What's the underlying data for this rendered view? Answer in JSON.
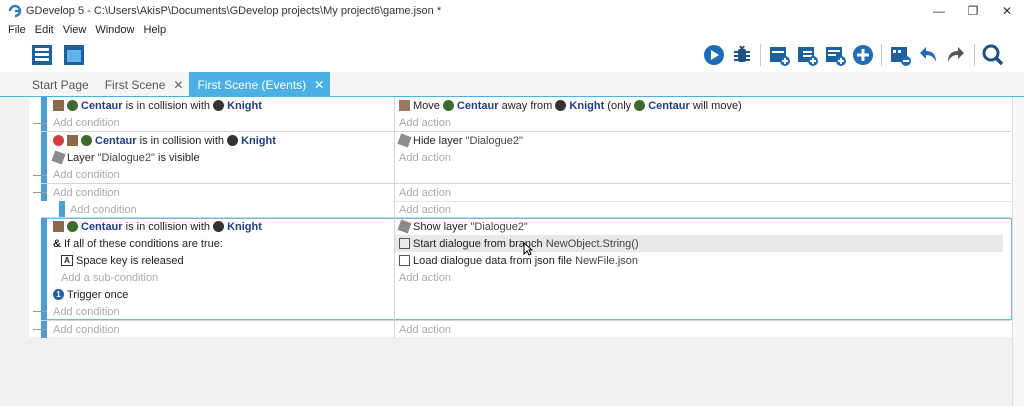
{
  "window": {
    "title": "GDevelop 5 - C:\\Users\\AkisP\\Documents\\GDevelop projects\\My project6\\game.json *",
    "controls": [
      "—",
      "❐",
      "✕"
    ]
  },
  "menu": [
    "File",
    "Edit",
    "View",
    "Window",
    "Help"
  ],
  "tabs": [
    {
      "label": "Start Page",
      "closable": false
    },
    {
      "label": "First Scene",
      "closable": true
    },
    {
      "label": "First Scene (Events)",
      "closable": true,
      "active": true
    }
  ],
  "events": {
    "add_condition": "Add condition",
    "add_action": "Add action",
    "add_subcondition": "Add a sub-condition",
    "e1": {
      "cond": {
        "obj1": "Centaur",
        "mid": "is in collision with",
        "obj2": "Knight"
      },
      "act": {
        "pre": "Move",
        "obj1": "Centaur",
        "mid": "away from",
        "obj2": "Knight",
        "post": "(only",
        "obj3": "Centaur",
        "end": "will move)"
      }
    },
    "e2": {
      "cond1": {
        "obj1": "Centaur",
        "mid": "is in collision with",
        "obj2": "Knight"
      },
      "cond2": {
        "pre": "Layer",
        "param": "\"Dialogue2\"",
        "post": "is visible"
      },
      "act": {
        "pre": "Hide layer",
        "param": "\"Dialogue2\""
      }
    },
    "e4": {
      "cond1": {
        "obj1": "Centaur",
        "mid": "is in collision with",
        "obj2": "Knight"
      },
      "cond2": "If all of these conditions are true:",
      "cond3": {
        "key": "Space",
        "post": "key is released"
      },
      "cond4": "Trigger once",
      "act1": {
        "pre": "Show layer",
        "param": "\"Dialogue2\""
      },
      "act2": {
        "pre": "Start dialogue from branch",
        "param": "NewObject.String()"
      },
      "act3": {
        "pre": "Load dialogue data from json file",
        "param": "NewFile.json"
      }
    }
  },
  "colors": {
    "accent": "#4ab0e6",
    "object": "#1c3e8a",
    "placeholder": "#aaaaaa"
  }
}
